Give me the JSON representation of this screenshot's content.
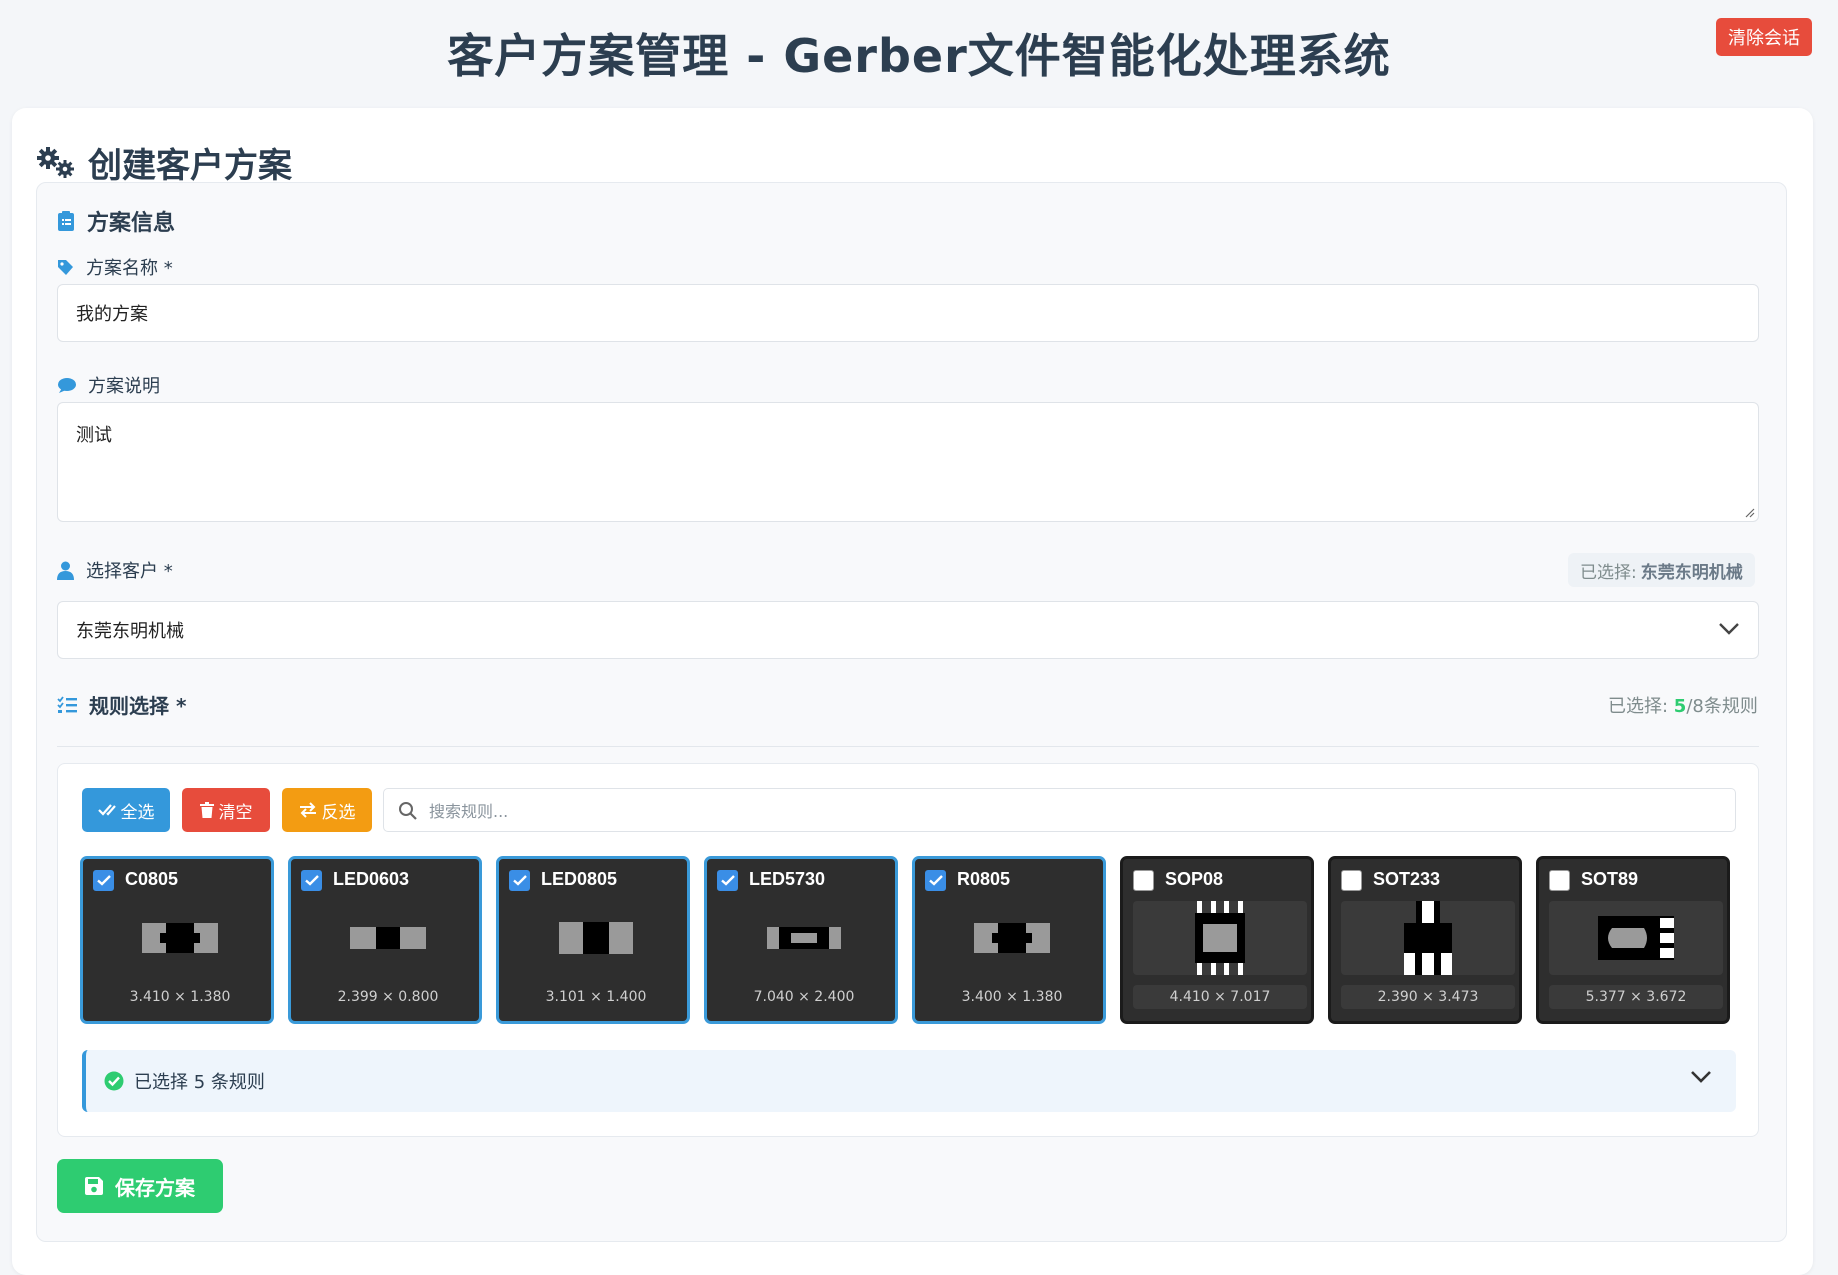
{
  "header": {
    "title": "客户方案管理 - Gerber文件智能化处理系统",
    "clear_session_label": "清除会话"
  },
  "card": {
    "title": "创建客户方案"
  },
  "plan_info": {
    "section_title": "方案信息",
    "name_label": "方案名称 *",
    "name_value": "我的方案",
    "desc_label": "方案说明",
    "desc_value": "测试",
    "customer_label": "选择客户 *",
    "customer_selected_prefix": "已选择:",
    "customer_selected_name": "东莞东明机械",
    "customer_value": "东莞东明机械"
  },
  "rules": {
    "section_title": "规则选择 *",
    "count_prefix": "已选择: ",
    "selected_count": "5",
    "count_suffix": "/8条规则",
    "select_all_label": "全选",
    "clear_label": "清空",
    "invert_label": "反选",
    "search_placeholder": "搜索规则...",
    "items": [
      {
        "name": "C0805",
        "size": "3.410 × 1.380",
        "checked": true
      },
      {
        "name": "LED0603",
        "size": "2.399 × 0.800",
        "checked": true
      },
      {
        "name": "LED0805",
        "size": "3.101 × 1.400",
        "checked": true
      },
      {
        "name": "LED5730",
        "size": "7.040 × 2.400",
        "checked": true
      },
      {
        "name": "R0805",
        "size": "3.400 × 1.380",
        "checked": true
      },
      {
        "name": "SOP08",
        "size": "4.410 × 7.017",
        "checked": false
      },
      {
        "name": "SOT233",
        "size": "2.390 × 3.473",
        "checked": false
      },
      {
        "name": "SOT89",
        "size": "5.377 × 3.672",
        "checked": false
      }
    ],
    "summary_text": "已选择 5 条规则"
  },
  "actions": {
    "save_label": "保存方案"
  },
  "colors": {
    "primary": "#3498db",
    "danger": "#e74c3c",
    "warning": "#f39c12",
    "success": "#2ecc71"
  }
}
